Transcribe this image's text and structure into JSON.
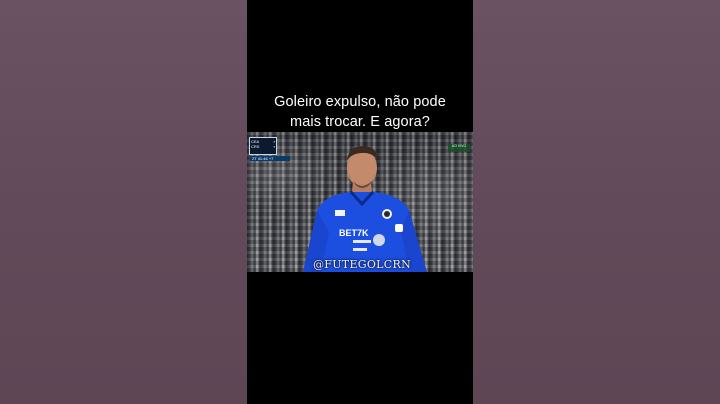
{
  "caption": {
    "line1": "Goleiro expulso, não pode",
    "line2": "mais trocar. E agora?"
  },
  "scorebug": {
    "home": "CEA",
    "away": "CRS",
    "time": "2T 41:46 +7"
  },
  "broadcast_tag": "AO VIVO",
  "jersey": {
    "sponsor": "BET7K"
  },
  "watermark": "@FUTEGOLCRN",
  "colors": {
    "page_background": "#654c5c",
    "player_background": "#000000",
    "jersey": "#1c4fe0"
  }
}
